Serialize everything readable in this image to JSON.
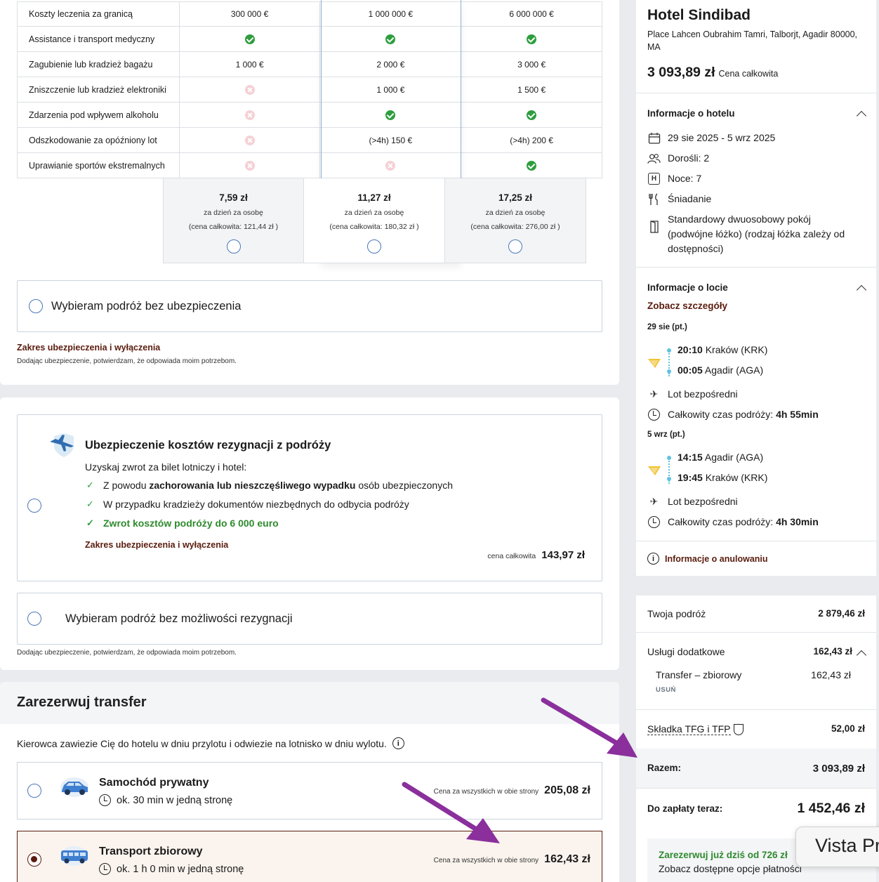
{
  "insurance_table": {
    "rows": [
      {
        "label": "Koszty leczenia za granicą",
        "cells": [
          "300 000 €",
          "1 000 000 €",
          "6 000 000 €"
        ]
      },
      {
        "label": "Assistance i transport medyczny",
        "cells": [
          "ok",
          "ok",
          "ok"
        ]
      },
      {
        "label": "Zagubienie lub kradzież bagażu",
        "cells": [
          "1 000 €",
          "2 000 €",
          "3 000 €"
        ]
      },
      {
        "label": "Zniszczenie lub kradzież elektroniki",
        "cells": [
          "no",
          "1 000 €",
          "1 500 €"
        ]
      },
      {
        "label": "Zdarzenia pod wpływem alkoholu",
        "cells": [
          "no",
          "ok",
          "ok"
        ]
      },
      {
        "label": "Odszkodowanie za opóźniony lot",
        "cells": [
          "no",
          "(>4h) 150 €",
          "(>4h) 200 €"
        ]
      },
      {
        "label": "Uprawianie sportów ekstremalnych",
        "cells": [
          "no",
          "no",
          "ok"
        ]
      }
    ],
    "prices": [
      {
        "price": "7,59 zł",
        "per": "za dzień za osobę",
        "total": "(cena całkowita: 121,44 zł )"
      },
      {
        "price": "11,27 zł",
        "per": "za dzień za osobę",
        "total": "(cena całkowita: 180,32 zł )"
      },
      {
        "price": "17,25 zł",
        "per": "za dzień za osobę",
        "total": "(cena całkowita: 276,00 zł )"
      }
    ],
    "no_insurance_label": "Wybieram podróż bez ubezpieczenia",
    "scope_link": "Zakres ubezpieczenia i wyłączenia",
    "consent": "Dodając ubezpieczenie, potwierdzam, że odpowiada moim potrzebom."
  },
  "resignation": {
    "title": "Ubezpieczenie kosztów rezygnacji z podróży",
    "subtitle": "Uzyskaj zwrot za bilet lotniczy i hotel:",
    "item1_pre": "Z powodu ",
    "item1_bold": "zachorowania lub nieszczęśliwego wypadku",
    "item1_post": " osób ubezpieczonych",
    "item2": "W przypadku kradzieży dokumentów niezbędnych do odbycia podróży",
    "item3": "Zwrot kosztów podróży do 6 000 euro",
    "scope_link": "Zakres ubezpieczenia i wyłączenia",
    "price_label": "cena całkowita",
    "price": "143,97 zł",
    "no_resign_label": "Wybieram podróż bez możliwości rezygnacji",
    "consent": "Dodając ubezpieczenie, potwierdzam, że odpowiada moim potrzebom."
  },
  "transfer": {
    "title": "Zarezerwuj transfer",
    "desc": "Kierowca zawiezie Cię do hotelu w dniu przylotu i odwiezie na lotnisko w dniu wylotu.",
    "options": [
      {
        "name": "Samochód prywatny",
        "time": "ok. 30 min w jedną stronę",
        "price_label": "Cena za wszystkich w obie strony",
        "price": "205,08 zł"
      },
      {
        "name": "Transport zbiorowy",
        "time": "ok. 1 h 0 min w jedną stronę",
        "price_label": "Cena za wszystkich w obie strony",
        "price": "162,43 zł"
      }
    ]
  },
  "hotel": {
    "name": "Hotel Sindibad",
    "address": "Place Lahcen Oubrahim Tamri, Talborjt, Agadir 80000, MA",
    "total": "3 093,89 zł",
    "total_label": "Cena całkowita",
    "info_title": "Informacje o hotelu",
    "dates": "29 sie 2025 - 5 wrz 2025",
    "adults": "Dorośli: 2",
    "nights": "Noce: 7",
    "board": "Śniadanie",
    "room": "Standardowy dwuosobowy pokój (podwójne łóżko) (rodzaj łóżka zależy od dostępności)"
  },
  "flight": {
    "title": "Informacje o locie",
    "details_link": "Zobacz szczegóły",
    "out_date": "29 sie (pt.)",
    "out_dep_time": "20:10",
    "out_dep_place": " Kraków (KRK)",
    "out_arr_time": "00:05",
    "out_arr_place": " Agadir (AGA)",
    "direct": "Lot bezpośredni",
    "duration_label": "Całkowity czas podróży: ",
    "out_duration": "4h 55min",
    "ret_date": "5 wrz (pt.)",
    "ret_dep_time": "14:15",
    "ret_dep_place": " Agadir (AGA)",
    "ret_arr_time": "19:45",
    "ret_arr_place": " Kraków (KRK)",
    "ret_duration": "4h 30min",
    "cancel_info": "Informacje o anulowaniu"
  },
  "summary": {
    "trip_label": "Twoja podróż",
    "trip_value": "2 879,46 zł",
    "extras_label": "Usługi dodatkowe",
    "extras_value": "162,43 zł",
    "transfer_label": "Transfer – zbiorowy",
    "transfer_value": "162,43 zł",
    "remove": "USUŃ",
    "tfg_label": "Składka TFG i TFP",
    "tfg_value": "52,00 zł",
    "total_label": "Razem:",
    "total_value": "3 093,89 zł",
    "pay_now_label": "Do zapłaty teraz:",
    "pay_now_value": "1 452,46 zł",
    "book_now": "Zarezerwuj już dziś od 726 zł",
    "pay_options": "Zobacz dostępne opcje płatności"
  },
  "overlay": {
    "vista": "Vista Pr"
  },
  "colors": {
    "accent_brown": "#5a1c0e",
    "check_green": "#2e9e3e",
    "arrow_purple": "#8a2f9c"
  }
}
